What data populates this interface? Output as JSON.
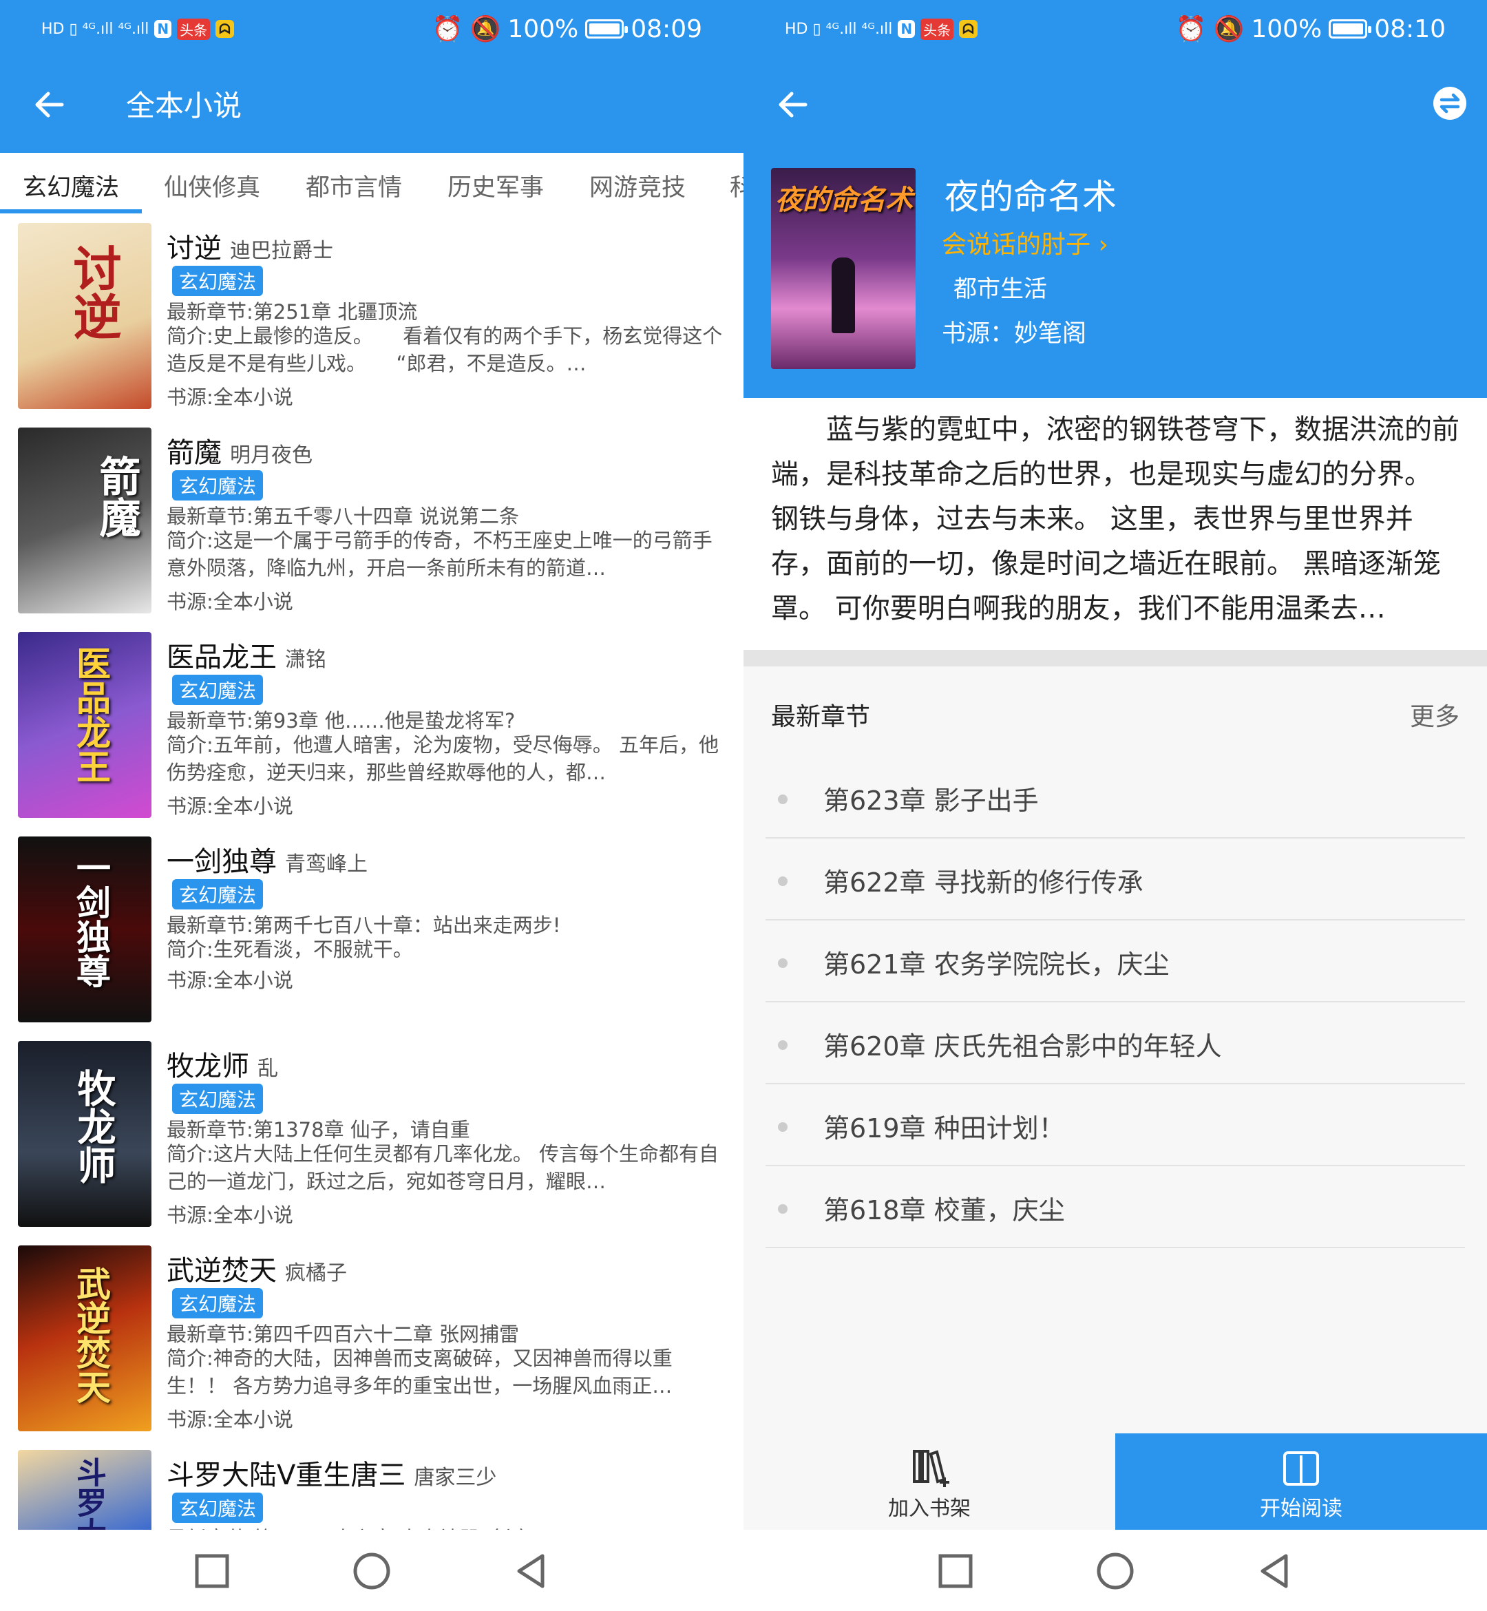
{
  "left": {
    "status": {
      "icons": "HD ▯ ⁴ᴳ.ıll ⁴ᴳ.ıll",
      "badge1": "N",
      "badge2": "头条",
      "battery": "100%",
      "time": "08:09"
    },
    "title": "全本小说",
    "tabs": [
      "玄幻魔法",
      "仙侠修真",
      "都市言情",
      "历史军事",
      "网游竞技",
      "科"
    ],
    "books": [
      {
        "title": "讨逆",
        "author": "迪巴拉爵士",
        "category": "玄幻魔法",
        "latest": "最新章节:第251章 北疆顶流",
        "intro": "简介:史上最惨的造反。　　看着仅有的两个手下，杨玄觉得这个造反是不是有些儿戏。　　“郎君，不是造反。…",
        "source": "书源:全本小说",
        "cover_text": "讨逆"
      },
      {
        "title": "箭魔",
        "author": "明月夜色",
        "category": "玄幻魔法",
        "latest": "最新章节:第五千零八十四章 说说第二条",
        "intro": "简介:这是一个属于弓箭手的传奇，不朽王座史上唯一的弓箭手意外陨落，降临九州，开启一条前所未有的箭道…",
        "source": "书源:全本小说",
        "cover_text": "箭魔"
      },
      {
        "title": "医品龙王",
        "author": "潇铭",
        "category": "玄幻魔法",
        "latest": "最新章节:第93章 他……他是蛰龙将军?",
        "intro": "简介:五年前，他遭人暗害，沦为废物，受尽侮辱。 五年后，他伤势痊愈，逆天归来，那些曾经欺辱他的人，都…",
        "source": "书源:全本小说",
        "cover_text": "医品龙王"
      },
      {
        "title": "一剑独尊",
        "author": "青鸾峰上",
        "category": "玄幻魔法",
        "latest": "最新章节:第两千七百八十章：站出来走两步!",
        "intro": "简介:生死看淡，不服就干。",
        "source": "书源:全本小说",
        "cover_text": "一剑独尊"
      },
      {
        "title": "牧龙师",
        "author": "乱",
        "category": "玄幻魔法",
        "latest": "最新章节:第1378章 仙子，请自重",
        "intro": "简介:这片大陆上任何生灵都有几率化龙。 传言每个生命都有自己的一道龙门，跃过之后，宛如苍穹日月，耀眼…",
        "source": "书源:全本小说",
        "cover_text": "牧龙师"
      },
      {
        "title": "武逆焚天",
        "author": "疯橘子",
        "category": "玄幻魔法",
        "latest": "最新章节:第四千四百六十二章 张网捕雷",
        "intro": "简介:神奇的大陆，因神兽而支离破碎，又因神兽而得以重生！！ 各方势力追寻多年的重宝出世，一场腥风血雨正…",
        "source": "书源:全本小说",
        "cover_text": "武逆焚天"
      },
      {
        "title": "斗罗大陆V重生唐三",
        "author": "唐家三少",
        "category": "玄幻魔法",
        "latest": "最新章节:第五百八十六章 十大神器（上）",
        "intro": "",
        "source": "",
        "cover_text": "斗罗大陆"
      }
    ]
  },
  "right": {
    "status": {
      "icons": "HD ▯ ⁴ᴳ.ıll ⁴ᴳ.ıll",
      "badge1": "N",
      "badge2": "头条",
      "battery": "100%",
      "time": "08:10"
    },
    "book": {
      "title": "夜的命名术",
      "author": "会说话的肘子 ›",
      "genre": "都市生活",
      "source": "书源：妙笔阁",
      "cover_text": "夜的命名术",
      "summary": "蓝与紫的霓虹中，浓密的钢铁苍穹下，数据洪流的前端，是科技革命之后的世界，也是现实与虚幻的分界。 钢铁与身体，过去与未来。 这里，表世界与里世界并存，面前的一切，像是时间之墙近在眼前。 黑暗逐渐笼罩。 可你要明白啊我的朋友，我们不能用温柔去…"
    },
    "latest_header": "最新章节",
    "more": "更多",
    "chapters": [
      "第623章 影子出手",
      "第622章 寻找新的修行传承",
      "第621章 农务学院院长，庆尘",
      "第620章 庆氏先祖合影中的年轻人",
      "第619章 种田计划！",
      "第618章 校董，庆尘"
    ],
    "add_shelf": "加入书架",
    "start_read": "开始阅读"
  },
  "colors": {
    "primary": "#2b95ee",
    "author_accent": "#ffb300"
  }
}
